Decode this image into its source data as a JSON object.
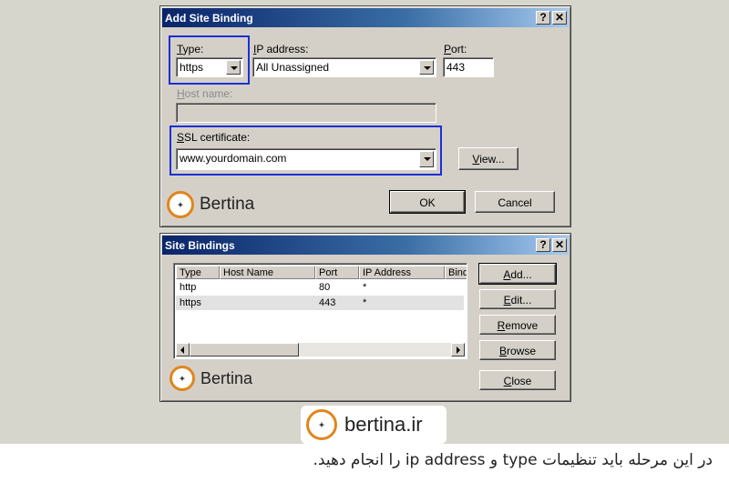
{
  "add_binding": {
    "title": "Add Site Binding",
    "help": "?",
    "close": "✕",
    "type_label_u": "T",
    "type_label_rest": "ype:",
    "type_value": "https",
    "ip_label_u": "I",
    "ip_label_rest": "P address:",
    "ip_value": "All Unassigned",
    "port_label_u": "P",
    "port_label_rest": "ort:",
    "port_value": "443",
    "host_label_u": "H",
    "host_label_rest": "ost name:",
    "ssl_label_u": "S",
    "ssl_label_rest": "SL certificate:",
    "ssl_value": "www.yourdomain.com",
    "view_label_u": "V",
    "view_label_rest": "iew...",
    "ok_label": "OK",
    "cancel_label": "Cancel",
    "logo_text": "Bertina"
  },
  "site_bindings": {
    "title": "Site Bindings",
    "help": "?",
    "close": "✕",
    "columns": [
      "Type",
      "Host Name",
      "Port",
      "IP Address",
      "Bind"
    ],
    "rows": [
      {
        "type": "http",
        "host": "",
        "port": "80",
        "ip": "*"
      },
      {
        "type": "https",
        "host": "",
        "port": "443",
        "ip": "*"
      }
    ],
    "add_u": "A",
    "add_rest": "dd...",
    "edit_u": "E",
    "edit_rest": "dit...",
    "remove_u": "R",
    "remove_rest": "emove",
    "browse_u": "B",
    "browse_rest": "rowse",
    "close_u": "C",
    "close_rest": "lose",
    "logo_text": "Bertina"
  },
  "footer": {
    "brand": "bertina.ir",
    "caption": "در این مرحله باید تنظیمات type و ip address را انجام دهید."
  },
  "colors": {
    "highlight": "#1b2fd8",
    "logo_ring": "#e0861b",
    "titlebar_start": "#0a246a"
  }
}
